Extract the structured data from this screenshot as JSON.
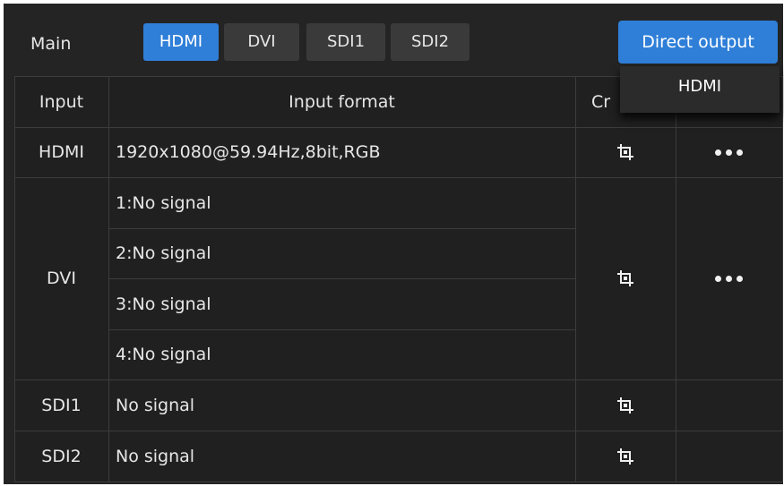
{
  "tabs": {
    "main_label": "Main",
    "items": [
      "HDMI",
      "DVI",
      "SDI1",
      "SDI2"
    ],
    "active": "HDMI"
  },
  "direct_output": {
    "label": "Direct output",
    "dropdown_options": [
      "HDMI"
    ]
  },
  "table": {
    "headers": {
      "input": "Input",
      "format": "Input format",
      "crop": "Cr"
    },
    "rows": {
      "hdmi": {
        "input": "HDMI",
        "format": "1920x1080@59.94Hz,8bit,RGB"
      },
      "dvi": {
        "input": "DVI",
        "formats": [
          "1:No signal",
          "2:No signal",
          "3:No signal",
          "4:No signal"
        ]
      },
      "sdi1": {
        "input": "SDI1",
        "format": "No signal"
      },
      "sdi2": {
        "input": "SDI2",
        "format": "No signal"
      }
    }
  },
  "icons": {
    "crop": "crop-icon",
    "more": "more-icon"
  },
  "colors": {
    "accent": "#2f7fd8",
    "panel": "#242424",
    "grid_line": "#3c3c3c"
  }
}
